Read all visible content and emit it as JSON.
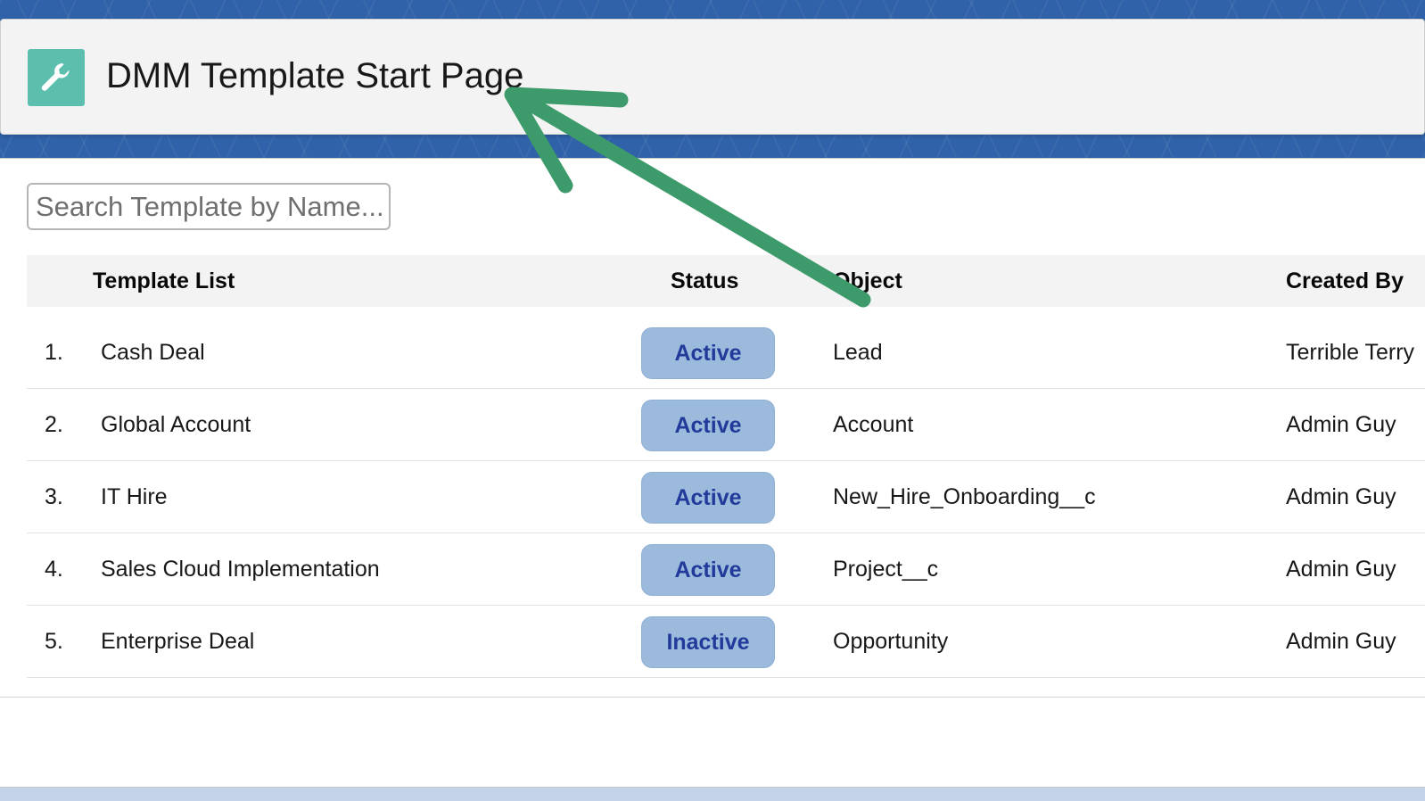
{
  "header": {
    "title": "DMM Template Start Page",
    "icon": "wrench-icon",
    "icon_color": "#5cbfae"
  },
  "search": {
    "placeholder": "Search Template by Name..."
  },
  "table": {
    "columns": [
      "Template List",
      "Status",
      "Object",
      "Created By"
    ],
    "rows": [
      {
        "index": "1.",
        "name": "Cash Deal",
        "status": "Active",
        "object": "Lead",
        "created_by": "Terrible Terry"
      },
      {
        "index": "2.",
        "name": "Global Account",
        "status": "Active",
        "object": "Account",
        "created_by": "Admin Guy"
      },
      {
        "index": "3.",
        "name": "IT Hire",
        "status": "Active",
        "object": "New_Hire_Onboarding__c",
        "created_by": "Admin Guy"
      },
      {
        "index": "4.",
        "name": "Sales Cloud Implementation",
        "status": "Active",
        "object": "Project__c",
        "created_by": "Admin Guy"
      },
      {
        "index": "5.",
        "name": "Enterprise Deal",
        "status": "Inactive",
        "object": "Opportunity",
        "created_by": "Admin Guy"
      }
    ]
  },
  "colors": {
    "background": "#2f62a8",
    "badge_bg": "#9cbadb",
    "badge_text": "#233a9b",
    "annotation_arrow": "#3d9a6a"
  },
  "annotation": {
    "icon": "arrow-annotation-icon"
  }
}
